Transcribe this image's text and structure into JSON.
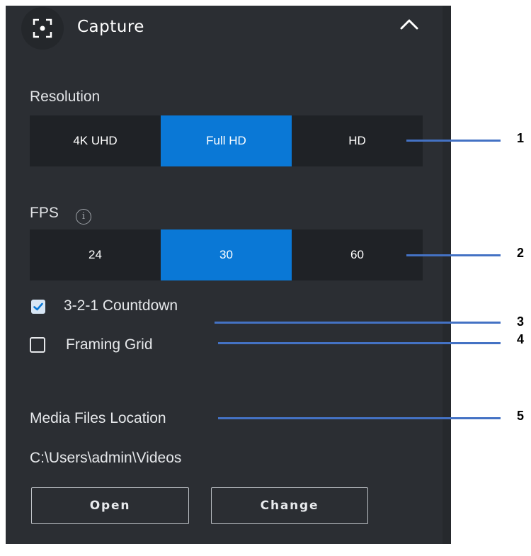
{
  "header": {
    "title": "Capture",
    "icon": "capture-frame-icon",
    "collapse_icon": "chevron-up-icon"
  },
  "resolution": {
    "label": "Resolution",
    "options": [
      "4K UHD",
      "Full HD",
      "HD"
    ],
    "selected": "Full HD"
  },
  "fps": {
    "label": "FPS",
    "info_icon": "info-icon",
    "options": [
      "24",
      "30",
      "60"
    ],
    "selected": "30"
  },
  "countdown": {
    "label": "3-2-1 Countdown",
    "checked": true
  },
  "framing_grid": {
    "label": "Framing Grid",
    "checked": false
  },
  "media": {
    "label": "Media Files Location",
    "path": "C:\\Users\\admin\\Videos",
    "open_label": "Open",
    "change_label": "Change"
  },
  "callouts": [
    "1",
    "2",
    "3",
    "4",
    "5"
  ],
  "colors": {
    "panel_bg": "#2b2e33",
    "segment_bg": "#1f2226",
    "accent": "#0a78d6",
    "callout_line": "#4472c4"
  }
}
